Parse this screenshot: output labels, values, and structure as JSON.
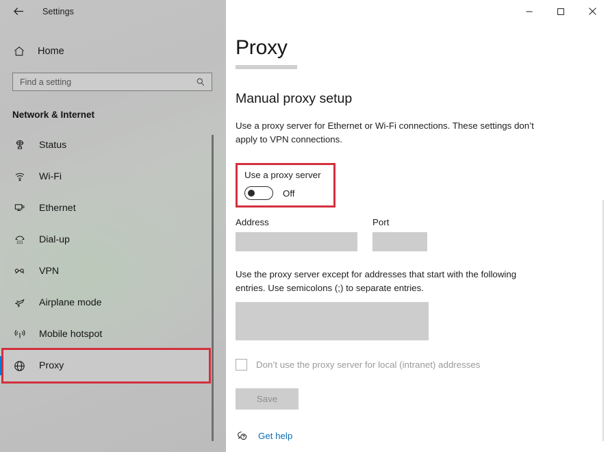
{
  "window": {
    "app_title": "Settings",
    "back_icon": "back-arrow-icon",
    "controls": {
      "minimize": "─",
      "maximize": "☐",
      "close": "✕"
    }
  },
  "sidebar": {
    "home": {
      "label": "Home",
      "icon": "home-icon"
    },
    "search": {
      "value": "",
      "placeholder": "Find a setting",
      "icon": "search-icon"
    },
    "section_title": "Network & Internet",
    "items": [
      {
        "label": "Status",
        "icon": "status-icon",
        "selected": false
      },
      {
        "label": "Wi-Fi",
        "icon": "wifi-icon",
        "selected": false
      },
      {
        "label": "Ethernet",
        "icon": "ethernet-icon",
        "selected": false
      },
      {
        "label": "Dial-up",
        "icon": "dialup-icon",
        "selected": false
      },
      {
        "label": "VPN",
        "icon": "vpn-icon",
        "selected": false
      },
      {
        "label": "Airplane mode",
        "icon": "airplane-icon",
        "selected": false
      },
      {
        "label": "Mobile hotspot",
        "icon": "hotspot-icon",
        "selected": false
      },
      {
        "label": "Proxy",
        "icon": "globe-icon",
        "selected": true
      }
    ]
  },
  "main": {
    "page_title": "Proxy",
    "section_heading": "Manual proxy setup",
    "description": "Use a proxy server for Ethernet or Wi-Fi connections. These settings don’t apply to VPN connections.",
    "toggle": {
      "label": "Use a proxy server",
      "state": "Off"
    },
    "address": {
      "label": "Address",
      "value": ""
    },
    "port": {
      "label": "Port",
      "value": ""
    },
    "exceptions_text": "Use the proxy server except for addresses that start with the following entries. Use semicolons (;) to separate entries.",
    "exceptions_value": "",
    "bypass_checkbox": {
      "label": "Don’t use the proxy server for local (intranet) addresses",
      "checked": false
    },
    "save_label": "Save",
    "get_help": {
      "label": "Get help",
      "icon": "help-bubble-icon"
    }
  },
  "annotations": {
    "highlight_color": "#d32f3c",
    "boxes": [
      "toggle-group",
      "sidebar-item-proxy"
    ]
  },
  "colors": {
    "accent": "#0078d7",
    "link": "#0b6cb5",
    "annotation_red": "#d32f3c",
    "disabled_field": "#cdcdcd",
    "sidebar_base": "#c0c0c0"
  }
}
